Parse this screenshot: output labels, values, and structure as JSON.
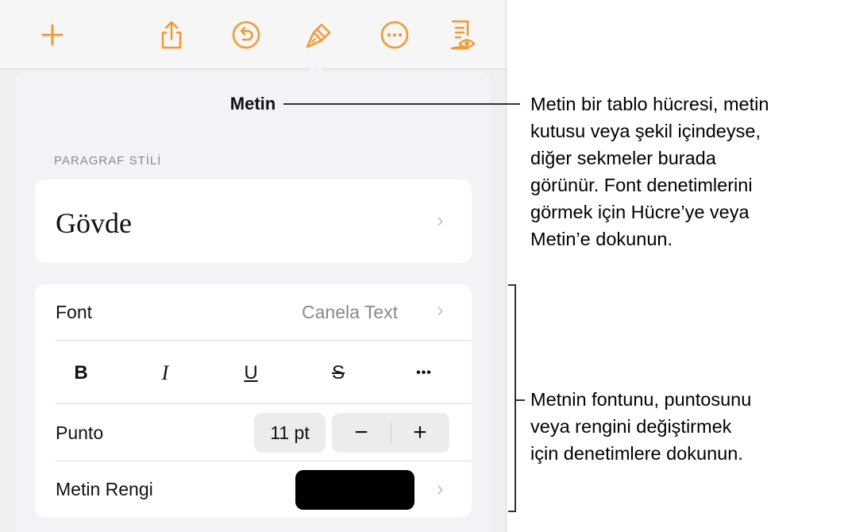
{
  "toolbar": {
    "accent_color": "#f09a37",
    "icons": [
      "plus-icon",
      "share-icon",
      "undo-icon",
      "paintbrush-icon",
      "more-icon",
      "reading-view-icon"
    ]
  },
  "popover": {
    "title": "Metin",
    "paragraph_style": {
      "section_label": "PARAGRAF STİLİ",
      "value": "Gövde"
    },
    "font": {
      "label": "Font",
      "value": "Canela Text"
    },
    "format_buttons": {
      "bold": "B",
      "italic": "I",
      "underline": "U",
      "strikethrough": "S",
      "more": "•••"
    },
    "size": {
      "label": "Punto",
      "value": "11 pt",
      "decrease": "−",
      "increase": "+"
    },
    "text_color": {
      "label": "Metin Rengi",
      "swatch_color": "#000000"
    }
  },
  "annotations": {
    "top": [
      "Metin bir tablo hücresi, metin",
      "kutusu veya şekil içindeyse,",
      "diğer sekmeler burada",
      "görünür. Font denetimlerini",
      "görmek için Hücre’ye veya",
      "Metin’e dokunun."
    ],
    "bottom": [
      "Metnin fontunu, puntosunu",
      "veya rengini değiştirmek",
      "için denetimlere dokunun."
    ]
  }
}
